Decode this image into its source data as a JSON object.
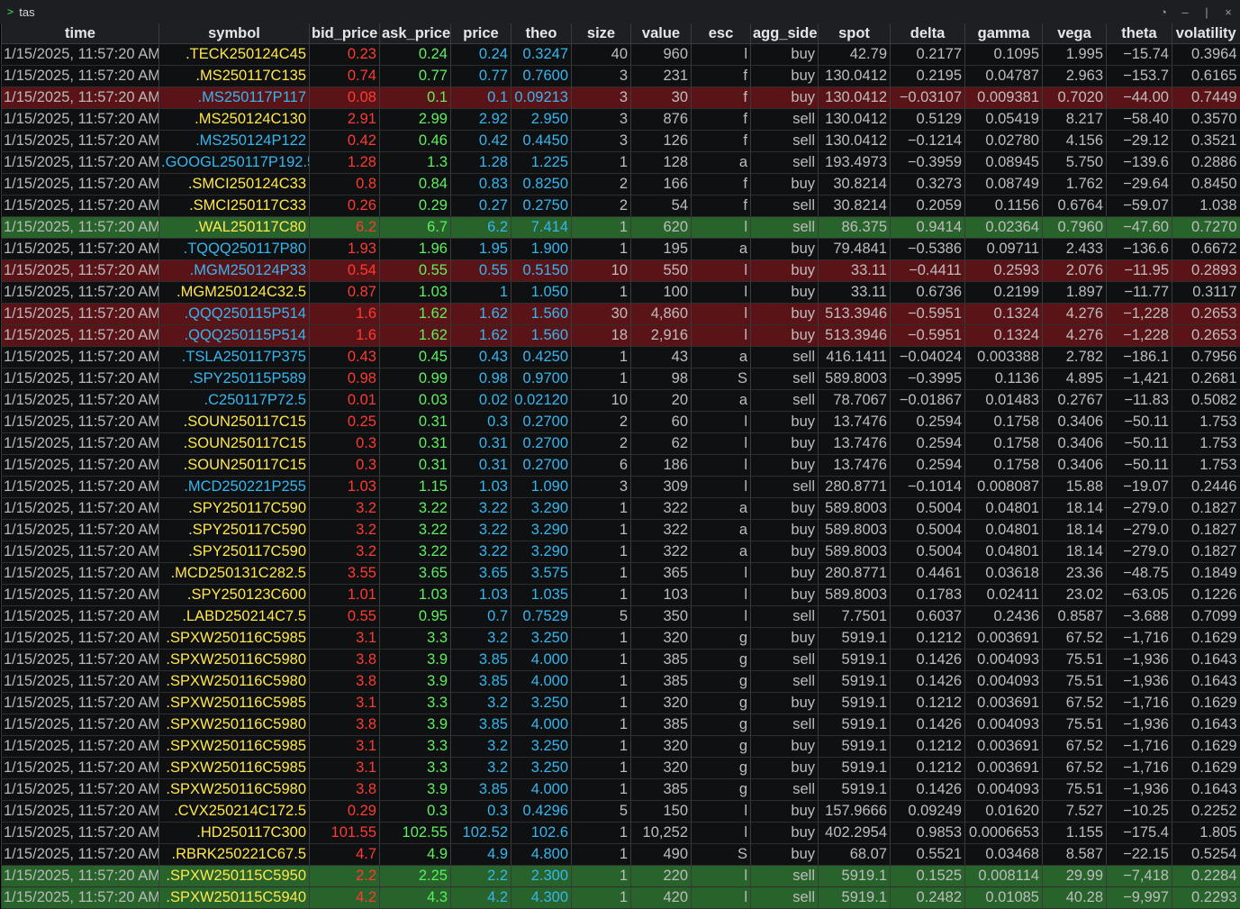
{
  "window": {
    "title": "tas",
    "prompt_icon": ">"
  },
  "columns": [
    "time",
    "symbol",
    "bid_price",
    "ask_price",
    "price",
    "theo",
    "size",
    "value",
    "esc",
    "agg_side",
    "spot",
    "delta",
    "gamma",
    "vega",
    "theta",
    "volatility"
  ],
  "colors": {
    "red_row": "#5a1418",
    "green_row": "#27632b",
    "bid": "#ff3b30",
    "ask": "#5df05f",
    "blue": "#36b6ee",
    "yellow": "#ffe74a"
  },
  "rows": [
    {
      "style": "normal",
      "sym_color": "yellow",
      "cells": [
        "1/15/2025, 11:57:20 AM",
        ".TECK250124C45",
        "0.23",
        "0.24",
        "0.24",
        "0.3247",
        "40",
        "960",
        "l",
        "buy",
        "42.79",
        "0.2177",
        "0.1095",
        "1.995",
        "−15.74",
        "0.3964"
      ]
    },
    {
      "style": "normal",
      "sym_color": "yellow",
      "cells": [
        "1/15/2025, 11:57:20 AM",
        ".MS250117C135",
        "0.74",
        "0.77",
        "0.77",
        "0.7600",
        "3",
        "231",
        "f",
        "buy",
        "130.0412",
        "0.2195",
        "0.04787",
        "2.963",
        "−153.7",
        "0.6165"
      ]
    },
    {
      "style": "red",
      "sym_color": "blue",
      "cells": [
        "1/15/2025, 11:57:20 AM",
        ".MS250117P117",
        "0.08",
        "0.1",
        "0.1",
        "0.09213",
        "3",
        "30",
        "f",
        "buy",
        "130.0412",
        "−0.03107",
        "0.009381",
        "0.7020",
        "−44.00",
        "0.7449"
      ]
    },
    {
      "style": "normal",
      "sym_color": "yellow",
      "cells": [
        "1/15/2025, 11:57:20 AM",
        ".MS250124C130",
        "2.91",
        "2.99",
        "2.92",
        "2.950",
        "3",
        "876",
        "f",
        "sell",
        "130.0412",
        "0.5129",
        "0.05419",
        "8.217",
        "−58.40",
        "0.3570"
      ]
    },
    {
      "style": "normal",
      "sym_color": "blue",
      "cells": [
        "1/15/2025, 11:57:20 AM",
        ".MS250124P122",
        "0.42",
        "0.46",
        "0.42",
        "0.4450",
        "3",
        "126",
        "f",
        "sell",
        "130.0412",
        "−0.1214",
        "0.02780",
        "4.156",
        "−29.12",
        "0.3521"
      ]
    },
    {
      "style": "normal",
      "sym_color": "blue",
      "cells": [
        "1/15/2025, 11:57:20 AM",
        ".GOOGL250117P192.5",
        "1.28",
        "1.3",
        "1.28",
        "1.225",
        "1",
        "128",
        "a",
        "sell",
        "193.4973",
        "−0.3959",
        "0.08945",
        "5.750",
        "−139.6",
        "0.2886"
      ]
    },
    {
      "style": "normal",
      "sym_color": "yellow",
      "cells": [
        "1/15/2025, 11:57:20 AM",
        ".SMCI250124C33",
        "0.8",
        "0.84",
        "0.83",
        "0.8250",
        "2",
        "166",
        "f",
        "buy",
        "30.8214",
        "0.3273",
        "0.08749",
        "1.762",
        "−29.64",
        "0.8450"
      ]
    },
    {
      "style": "normal",
      "sym_color": "yellow",
      "cells": [
        "1/15/2025, 11:57:20 AM",
        ".SMCI250117C33",
        "0.26",
        "0.29",
        "0.27",
        "0.2750",
        "2",
        "54",
        "f",
        "sell",
        "30.8214",
        "0.2059",
        "0.1156",
        "0.6764",
        "−59.07",
        "1.038"
      ]
    },
    {
      "style": "green",
      "sym_color": "yellow",
      "cells": [
        "1/15/2025, 11:57:20 AM",
        ".WAL250117C80",
        "6.2",
        "6.7",
        "6.2",
        "7.414",
        "1",
        "620",
        "l",
        "sell",
        "86.375",
        "0.9414",
        "0.02364",
        "0.7960",
        "−47.60",
        "0.7270"
      ]
    },
    {
      "style": "normal",
      "sym_color": "blue",
      "cells": [
        "1/15/2025, 11:57:20 AM",
        ".TQQQ250117P80",
        "1.93",
        "1.96",
        "1.95",
        "1.900",
        "1",
        "195",
        "a",
        "buy",
        "79.4841",
        "−0.5386",
        "0.09711",
        "2.433",
        "−136.6",
        "0.6672"
      ]
    },
    {
      "style": "red",
      "sym_color": "blue",
      "cells": [
        "1/15/2025, 11:57:20 AM",
        ".MGM250124P33",
        "0.54",
        "0.55",
        "0.55",
        "0.5150",
        "10",
        "550",
        "l",
        "buy",
        "33.11",
        "−0.4411",
        "0.2593",
        "2.076",
        "−11.95",
        "0.2893"
      ]
    },
    {
      "style": "normal",
      "sym_color": "yellow",
      "cells": [
        "1/15/2025, 11:57:20 AM",
        ".MGM250124C32.5",
        "0.87",
        "1.03",
        "1",
        "1.050",
        "1",
        "100",
        "l",
        "buy",
        "33.11",
        "0.6736",
        "0.2199",
        "1.897",
        "−11.77",
        "0.3117"
      ]
    },
    {
      "style": "red",
      "sym_color": "blue",
      "cells": [
        "1/15/2025, 11:57:20 AM",
        ".QQQ250115P514",
        "1.6",
        "1.62",
        "1.62",
        "1.560",
        "30",
        "4,860",
        "l",
        "buy",
        "513.3946",
        "−0.5951",
        "0.1324",
        "4.276",
        "−1,228",
        "0.2653"
      ]
    },
    {
      "style": "red",
      "sym_color": "blue",
      "cells": [
        "1/15/2025, 11:57:20 AM",
        ".QQQ250115P514",
        "1.6",
        "1.62",
        "1.62",
        "1.560",
        "18",
        "2,916",
        "l",
        "buy",
        "513.3946",
        "−0.5951",
        "0.1324",
        "4.276",
        "−1,228",
        "0.2653"
      ]
    },
    {
      "style": "normal",
      "sym_color": "blue",
      "cells": [
        "1/15/2025, 11:57:20 AM",
        ".TSLA250117P375",
        "0.43",
        "0.45",
        "0.43",
        "0.4250",
        "1",
        "43",
        "a",
        "sell",
        "416.1411",
        "−0.04024",
        "0.003388",
        "2.782",
        "−186.1",
        "0.7956"
      ]
    },
    {
      "style": "normal",
      "sym_color": "blue",
      "cells": [
        "1/15/2025, 11:57:20 AM",
        ".SPY250115P589",
        "0.98",
        "0.99",
        "0.98",
        "0.9700",
        "1",
        "98",
        "S",
        "sell",
        "589.8003",
        "−0.3995",
        "0.1136",
        "4.895",
        "−1,421",
        "0.2681"
      ]
    },
    {
      "style": "normal",
      "sym_color": "blue",
      "cells": [
        "1/15/2025, 11:57:20 AM",
        ".C250117P72.5",
        "0.01",
        "0.03",
        "0.02",
        "0.02120",
        "10",
        "20",
        "a",
        "sell",
        "78.7067",
        "−0.01867",
        "0.01483",
        "0.2767",
        "−11.83",
        "0.5082"
      ]
    },
    {
      "style": "normal",
      "sym_color": "yellow",
      "cells": [
        "1/15/2025, 11:57:20 AM",
        ".SOUN250117C15",
        "0.25",
        "0.31",
        "0.3",
        "0.2700",
        "2",
        "60",
        "l",
        "buy",
        "13.7476",
        "0.2594",
        "0.1758",
        "0.3406",
        "−50.11",
        "1.753"
      ]
    },
    {
      "style": "normal",
      "sym_color": "yellow",
      "cells": [
        "1/15/2025, 11:57:20 AM",
        ".SOUN250117C15",
        "0.3",
        "0.31",
        "0.31",
        "0.2700",
        "2",
        "62",
        "l",
        "buy",
        "13.7476",
        "0.2594",
        "0.1758",
        "0.3406",
        "−50.11",
        "1.753"
      ]
    },
    {
      "style": "normal",
      "sym_color": "yellow",
      "cells": [
        "1/15/2025, 11:57:20 AM",
        ".SOUN250117C15",
        "0.3",
        "0.31",
        "0.31",
        "0.2700",
        "6",
        "186",
        "l",
        "buy",
        "13.7476",
        "0.2594",
        "0.1758",
        "0.3406",
        "−50.11",
        "1.753"
      ]
    },
    {
      "style": "normal",
      "sym_color": "blue",
      "cells": [
        "1/15/2025, 11:57:20 AM",
        ".MCD250221P255",
        "1.03",
        "1.15",
        "1.03",
        "1.090",
        "3",
        "309",
        "l",
        "sell",
        "280.8771",
        "−0.1014",
        "0.008087",
        "15.88",
        "−19.07",
        "0.2446"
      ]
    },
    {
      "style": "normal",
      "sym_color": "yellow",
      "cells": [
        "1/15/2025, 11:57:20 AM",
        ".SPY250117C590",
        "3.2",
        "3.22",
        "3.22",
        "3.290",
        "1",
        "322",
        "a",
        "buy",
        "589.8003",
        "0.5004",
        "0.04801",
        "18.14",
        "−279.0",
        "0.1827"
      ]
    },
    {
      "style": "normal",
      "sym_color": "yellow",
      "cells": [
        "1/15/2025, 11:57:20 AM",
        ".SPY250117C590",
        "3.2",
        "3.22",
        "3.22",
        "3.290",
        "1",
        "322",
        "a",
        "buy",
        "589.8003",
        "0.5004",
        "0.04801",
        "18.14",
        "−279.0",
        "0.1827"
      ]
    },
    {
      "style": "normal",
      "sym_color": "yellow",
      "cells": [
        "1/15/2025, 11:57:20 AM",
        ".SPY250117C590",
        "3.2",
        "3.22",
        "3.22",
        "3.290",
        "1",
        "322",
        "a",
        "buy",
        "589.8003",
        "0.5004",
        "0.04801",
        "18.14",
        "−279.0",
        "0.1827"
      ]
    },
    {
      "style": "normal",
      "sym_color": "yellow",
      "cells": [
        "1/15/2025, 11:57:20 AM",
        ".MCD250131C282.5",
        "3.55",
        "3.65",
        "3.65",
        "3.575",
        "1",
        "365",
        "l",
        "buy",
        "280.8771",
        "0.4461",
        "0.03618",
        "23.36",
        "−48.75",
        "0.1849"
      ]
    },
    {
      "style": "normal",
      "sym_color": "yellow",
      "cells": [
        "1/15/2025, 11:57:20 AM",
        ".SPY250123C600",
        "1.01",
        "1.03",
        "1.03",
        "1.035",
        "1",
        "103",
        "l",
        "buy",
        "589.8003",
        "0.1783",
        "0.02411",
        "23.02",
        "−63.05",
        "0.1226"
      ]
    },
    {
      "style": "normal",
      "sym_color": "yellow",
      "cells": [
        "1/15/2025, 11:57:20 AM",
        ".LABD250214C7.5",
        "0.55",
        "0.95",
        "0.7",
        "0.7529",
        "5",
        "350",
        "l",
        "sell",
        "7.7501",
        "0.6037",
        "0.2436",
        "0.8587",
        "−3.688",
        "0.7099"
      ]
    },
    {
      "style": "normal",
      "sym_color": "yellow",
      "cells": [
        "1/15/2025, 11:57:20 AM",
        ".SPXW250116C5985",
        "3.1",
        "3.3",
        "3.2",
        "3.250",
        "1",
        "320",
        "g",
        "buy",
        "5919.1",
        "0.1212",
        "0.003691",
        "67.52",
        "−1,716",
        "0.1629"
      ]
    },
    {
      "style": "normal",
      "sym_color": "yellow",
      "cells": [
        "1/15/2025, 11:57:20 AM",
        ".SPXW250116C5980",
        "3.8",
        "3.9",
        "3.85",
        "4.000",
        "1",
        "385",
        "g",
        "sell",
        "5919.1",
        "0.1426",
        "0.004093",
        "75.51",
        "−1,936",
        "0.1643"
      ]
    },
    {
      "style": "normal",
      "sym_color": "yellow",
      "cells": [
        "1/15/2025, 11:57:20 AM",
        ".SPXW250116C5980",
        "3.8",
        "3.9",
        "3.85",
        "4.000",
        "1",
        "385",
        "g",
        "sell",
        "5919.1",
        "0.1426",
        "0.004093",
        "75.51",
        "−1,936",
        "0.1643"
      ]
    },
    {
      "style": "normal",
      "sym_color": "yellow",
      "cells": [
        "1/15/2025, 11:57:20 AM",
        ".SPXW250116C5985",
        "3.1",
        "3.3",
        "3.2",
        "3.250",
        "1",
        "320",
        "g",
        "buy",
        "5919.1",
        "0.1212",
        "0.003691",
        "67.52",
        "−1,716",
        "0.1629"
      ]
    },
    {
      "style": "normal",
      "sym_color": "yellow",
      "cells": [
        "1/15/2025, 11:57:20 AM",
        ".SPXW250116C5980",
        "3.8",
        "3.9",
        "3.85",
        "4.000",
        "1",
        "385",
        "g",
        "sell",
        "5919.1",
        "0.1426",
        "0.004093",
        "75.51",
        "−1,936",
        "0.1643"
      ]
    },
    {
      "style": "normal",
      "sym_color": "yellow",
      "cells": [
        "1/15/2025, 11:57:20 AM",
        ".SPXW250116C5985",
        "3.1",
        "3.3",
        "3.2",
        "3.250",
        "1",
        "320",
        "g",
        "buy",
        "5919.1",
        "0.1212",
        "0.003691",
        "67.52",
        "−1,716",
        "0.1629"
      ]
    },
    {
      "style": "normal",
      "sym_color": "yellow",
      "cells": [
        "1/15/2025, 11:57:20 AM",
        ".SPXW250116C5985",
        "3.1",
        "3.3",
        "3.2",
        "3.250",
        "1",
        "320",
        "g",
        "buy",
        "5919.1",
        "0.1212",
        "0.003691",
        "67.52",
        "−1,716",
        "0.1629"
      ]
    },
    {
      "style": "normal",
      "sym_color": "yellow",
      "cells": [
        "1/15/2025, 11:57:20 AM",
        ".SPXW250116C5980",
        "3.8",
        "3.9",
        "3.85",
        "4.000",
        "1",
        "385",
        "g",
        "sell",
        "5919.1",
        "0.1426",
        "0.004093",
        "75.51",
        "−1,936",
        "0.1643"
      ]
    },
    {
      "style": "normal",
      "sym_color": "yellow",
      "cells": [
        "1/15/2025, 11:57:20 AM",
        ".CVX250214C172.5",
        "0.29",
        "0.3",
        "0.3",
        "0.4296",
        "5",
        "150",
        "l",
        "buy",
        "157.9666",
        "0.09249",
        "0.01620",
        "7.527",
        "−10.25",
        "0.2252"
      ]
    },
    {
      "style": "normal",
      "sym_color": "yellow",
      "cells": [
        "1/15/2025, 11:57:20 AM",
        ".HD250117C300",
        "101.55",
        "102.55",
        "102.52",
        "102.6",
        "1",
        "10,252",
        "l",
        "buy",
        "402.2954",
        "0.9853",
        "0.0006653",
        "1.155",
        "−175.4",
        "1.805"
      ]
    },
    {
      "style": "normal",
      "sym_color": "yellow",
      "cells": [
        "1/15/2025, 11:57:20 AM",
        ".RBRK250221C67.5",
        "4.7",
        "4.9",
        "4.9",
        "4.800",
        "1",
        "490",
        "S",
        "buy",
        "68.07",
        "0.5521",
        "0.03468",
        "8.587",
        "−22.15",
        "0.5254"
      ]
    },
    {
      "style": "green",
      "sym_color": "yellow",
      "cells": [
        "1/15/2025, 11:57:20 AM",
        ".SPXW250115C5950",
        "2.2",
        "2.25",
        "2.2",
        "2.300",
        "1",
        "220",
        "l",
        "sell",
        "5919.1",
        "0.1525",
        "0.008114",
        "29.99",
        "−7,418",
        "0.2284"
      ]
    },
    {
      "style": "green",
      "sym_color": "yellow",
      "cells": [
        "1/15/2025, 11:57:20 AM",
        ".SPXW250115C5940",
        "4.2",
        "4.3",
        "4.2",
        "4.300",
        "1",
        "420",
        "l",
        "sell",
        "5919.1",
        "0.2482",
        "0.01085",
        "40.28",
        "−9,997",
        "0.2293"
      ]
    }
  ]
}
